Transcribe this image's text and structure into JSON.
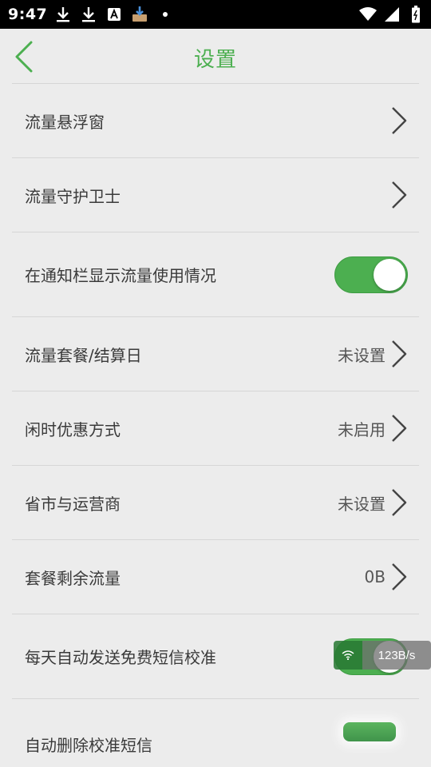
{
  "status_bar": {
    "time": "9:47",
    "left_icons": [
      "download-icon",
      "download-icon",
      "a-letter-icon",
      "installer-icon",
      "dot-icon"
    ],
    "right_icons": [
      "wifi-icon",
      "signal-icon",
      "battery-icon"
    ]
  },
  "header": {
    "title": "设置",
    "back_icon": "chevron-left-icon"
  },
  "settings": [
    {
      "label": "流量悬浮窗",
      "type": "nav",
      "value": ""
    },
    {
      "label": "流量守护卫士",
      "type": "nav",
      "value": ""
    },
    {
      "label": "在通知栏显示流量使用情况",
      "type": "toggle",
      "on": true
    },
    {
      "label": "流量套餐/结算日",
      "type": "nav",
      "value": "未设置"
    },
    {
      "label": "闲时优惠方式",
      "type": "nav",
      "value": "未启用"
    },
    {
      "label": "省市与运营商",
      "type": "nav",
      "value": "未设置"
    },
    {
      "label": "套餐剩余流量",
      "type": "nav",
      "value": "0B"
    },
    {
      "label": "每天自动发送免费短信校准",
      "type": "toggle",
      "on": true
    },
    {
      "label": "自动删除校准短信",
      "type": "toggle",
      "on": true
    }
  ],
  "speed_overlay": {
    "icon": "wifi-icon",
    "text": "123B/s"
  },
  "colors": {
    "accent": "#4caf50",
    "background": "#ececec",
    "divider": "#d6d6d6"
  }
}
